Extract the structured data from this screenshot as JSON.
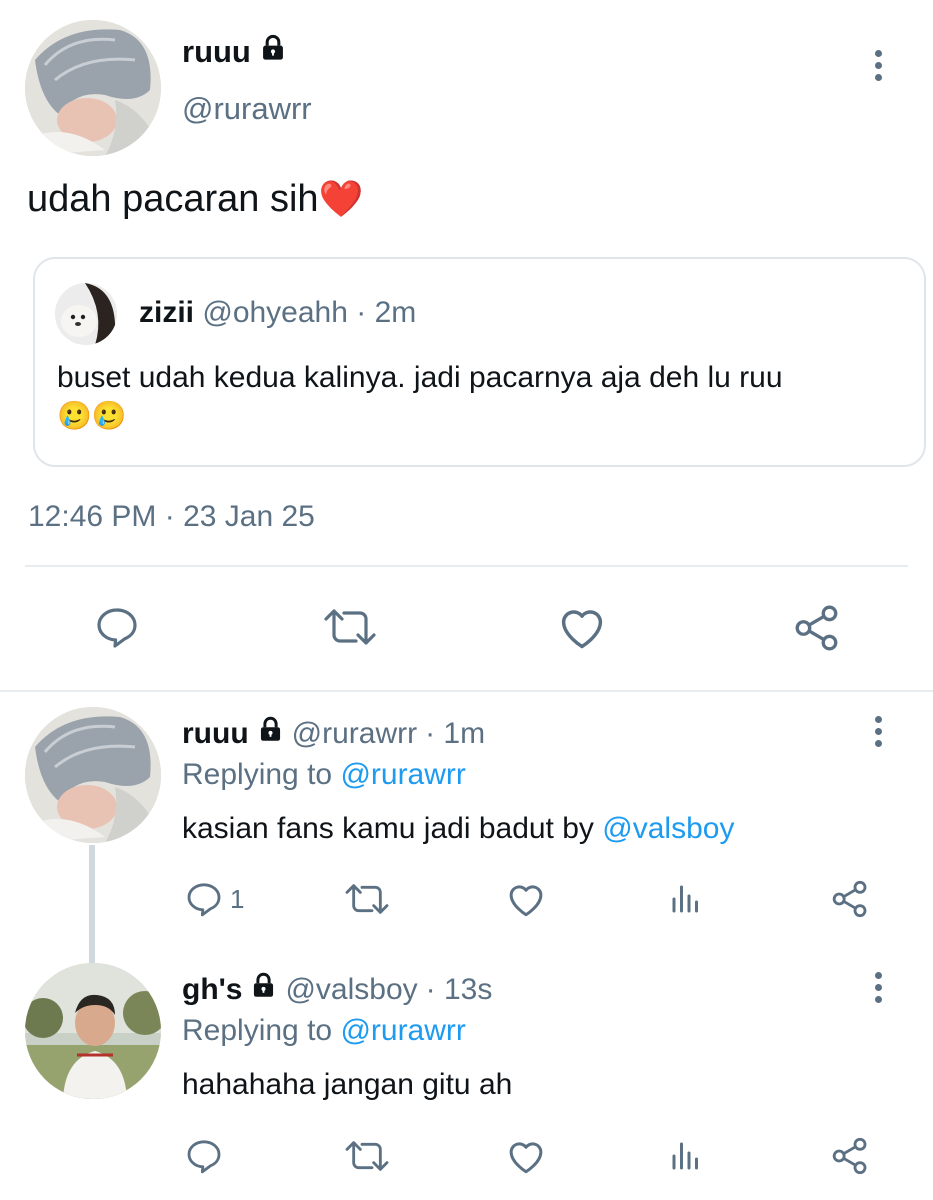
{
  "main_tweet": {
    "display_name": "ruuu",
    "handle": "@rurawrr",
    "text": "udah pacaran sih",
    "emoji": "❤️",
    "timestamp": "12:46 PM · 23 Jan 25",
    "avatar_icon": "user-avatar-blanket"
  },
  "quoted_tweet": {
    "display_name": "zizii",
    "handle": "@ohyeahh",
    "time": "· 2m",
    "text": "buset udah kedua kalinya. jadi pacarnya aja deh lu ruu",
    "emoji": "🥲🥲",
    "avatar_icon": "user-avatar-dog"
  },
  "main_actions": [
    "reply-icon",
    "retweet-icon",
    "like-icon",
    "share-icon"
  ],
  "replies": [
    {
      "display_name": "ruuu",
      "handle": "@rurawrr",
      "time": "· 1m",
      "replying_prefix": "Replying to",
      "replying_to": "@rurawrr",
      "text": "kasian fans kamu jadi badut by",
      "mention": "@valsboy",
      "reply_count": "1",
      "avatar_icon": "user-avatar-blanket"
    },
    {
      "display_name": "gh's",
      "handle": "@valsboy",
      "time": "· 13s",
      "replying_prefix": "Replying to",
      "replying_to": "@rurawrr",
      "text": "hahahaha jangan gitu ah",
      "mention": "",
      "reply_count": "",
      "avatar_icon": "user-avatar-boy"
    }
  ],
  "colors": {
    "link": "#1d9bf0",
    "secondary_text": "#5b7083",
    "divider": "#e6ecf0",
    "heart": "#e0245e"
  }
}
